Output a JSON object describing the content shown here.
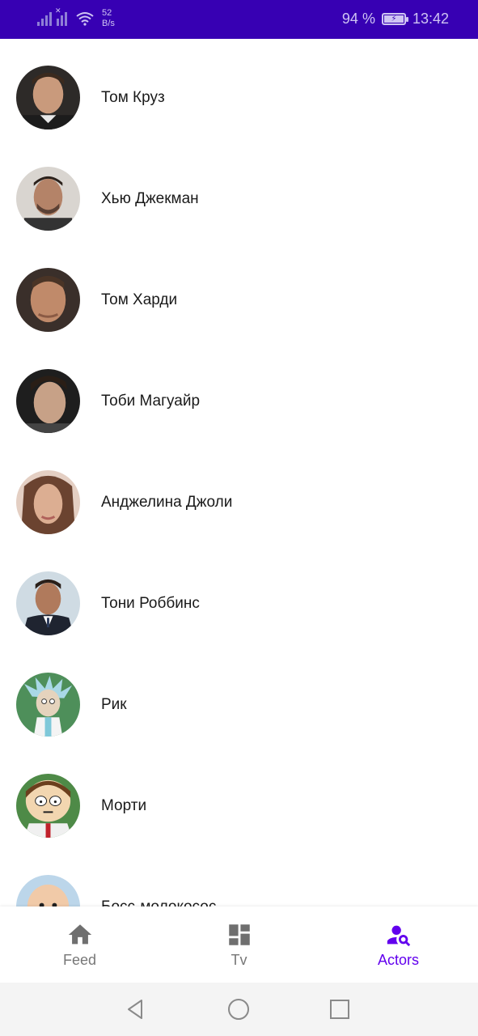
{
  "status_bar": {
    "net_speed_value": "52",
    "net_speed_unit": "B/s",
    "battery": "94 %",
    "time": "13:42",
    "colors": {
      "background": "#3700b3"
    }
  },
  "actors": [
    {
      "name": "Том Круз",
      "avatar": "tom-cruise-photo"
    },
    {
      "name": "Хью Джекман",
      "avatar": "hugh-jackman-photo"
    },
    {
      "name": "Том Харди",
      "avatar": "tom-hardy-photo"
    },
    {
      "name": "Тоби Магуайр",
      "avatar": "tobey-maguire-photo"
    },
    {
      "name": "Анджелина Джоли",
      "avatar": "angelina-jolie-photo"
    },
    {
      "name": "Тони Роббинс",
      "avatar": "tony-robbins-photo"
    },
    {
      "name": "Рик",
      "avatar": "rick-cartoon"
    },
    {
      "name": "Морти",
      "avatar": "morty-cartoon"
    },
    {
      "name": "Босс-молокосос",
      "avatar": "boss-baby-cartoon"
    }
  ],
  "bottom_nav": {
    "items": [
      {
        "label": "Feed",
        "icon": "home-icon"
      },
      {
        "label": "Tv",
        "icon": "dashboard-icon"
      },
      {
        "label": "Actors",
        "icon": "person-search-icon"
      }
    ],
    "active": "Actors",
    "colors": {
      "active": "#6200ee",
      "inactive": "#777777"
    }
  },
  "system_nav": {
    "buttons": [
      "back-icon",
      "home-circle-icon",
      "recents-icon"
    ]
  }
}
